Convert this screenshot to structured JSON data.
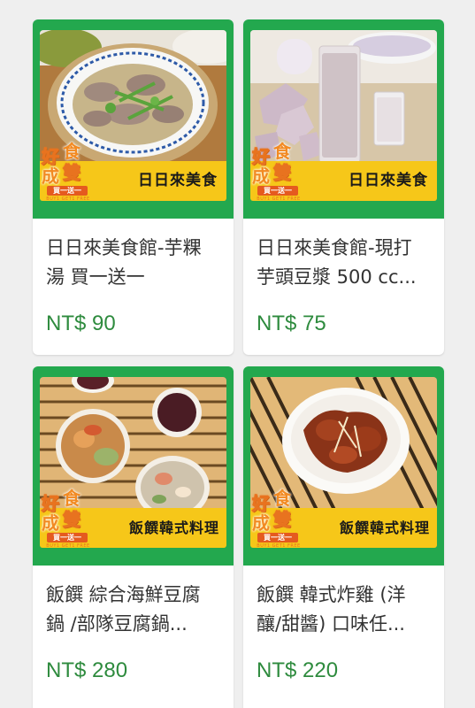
{
  "products": [
    {
      "shop": "日日來美食",
      "badge": {
        "chars": [
          "好",
          "食",
          "成",
          "雙"
        ],
        "ribbon": "買一送一",
        "tagline": "BUY1 GET1 FREE"
      },
      "title_line1": "日日來美食館-芋粿",
      "title_line2": "湯 買一送一",
      "price": "NT$ 90",
      "photo": "taro-soup-bowl"
    },
    {
      "shop": "日日來美食",
      "badge": {
        "chars": [
          "好",
          "食",
          "成",
          "雙"
        ],
        "ribbon": "買一送一",
        "tagline": "BUY1 GET1 FREE"
      },
      "title_line1": "日日來美食館-現打",
      "title_line2": "芋頭豆漿 500 cc...",
      "price": "NT$ 75",
      "photo": "taro-soy-milk"
    },
    {
      "shop": "飯饌韓式料理",
      "badge": {
        "chars": [
          "好",
          "食",
          "成",
          "雙"
        ],
        "ribbon": "買一送一",
        "tagline": "BUY1 GET1 FREE"
      },
      "title_line1": "飯饌 綜合海鮮豆腐",
      "title_line2": "鍋 /部隊豆腐鍋...",
      "price": "NT$ 280",
      "photo": "seafood-tofu-pot-set"
    },
    {
      "shop": "飯饌韓式料理",
      "badge": {
        "chars": [
          "好",
          "食",
          "成",
          "雙"
        ],
        "ribbon": "買一送一",
        "tagline": "BUY1 GET1 FREE"
      },
      "title_line1": "飯饌 韓式炸雞 (洋",
      "title_line2": "釀/甜醬) 口味任...",
      "price": "NT$ 220",
      "photo": "korean-fried-chicken"
    }
  ],
  "colors": {
    "frame_green": "#23a84e",
    "banner_yellow": "#f6c719",
    "price_green": "#2e8b3e",
    "background": "#efefef"
  }
}
